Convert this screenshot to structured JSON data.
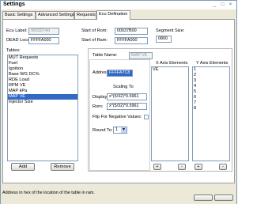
{
  "window": {
    "title": "Settings"
  },
  "tabs": [
    {
      "label": "Basic Settings"
    },
    {
      "label": "Advanced Settings"
    },
    {
      "label": "Requests"
    },
    {
      "label": "Ecu Defination"
    }
  ],
  "ecu_label": {
    "label": "Ecu Label:",
    "value": "9653074d"
  },
  "dead_location": {
    "label": "DEAD Location:",
    "value": "FFFFA000"
  },
  "start_of_rom": {
    "label": "Start of Rom:",
    "value": "00037B00"
  },
  "start_of_ram": {
    "label": "Start of Ram:",
    "value": "FFFFA000"
  },
  "segment_size": {
    "label": "Segment Size:",
    "value": "0800"
  },
  "tables": {
    "label": "Tables:",
    "items": [
      "MUT Requests",
      "Fuel",
      "Ignition",
      "Base WG DC%",
      "RDE Load",
      "RPM VE",
      "MAP kPa",
      "MAP VE",
      "Injector Size"
    ],
    "selected": "MAP VE",
    "add_label": "Add",
    "remove_label": "Remove"
  },
  "table": {
    "name_label": "Table Name:",
    "name_value": "MAP VE",
    "address_label": "Address:",
    "address_value": "FFFFA7C8",
    "scaling_label": "Scaling To",
    "display_label": "Display:",
    "display_value": "x*(5/32)*0.5961",
    "rom_label": "Rom:",
    "rom_value": "x*(5/32)*0.5961",
    "flip_label": "Flip For Negative Values:",
    "round_label": "Round To:",
    "round_value": "1"
  },
  "x_axis": {
    "label": "X Axis Elements",
    "items": [
      "VE"
    ],
    "add": "+",
    "remove": "-"
  },
  "y_axis": {
    "label": "Y Axis Elements",
    "items": [
      "1",
      "2",
      "3",
      "4",
      "5",
      "6",
      "7",
      "8"
    ],
    "add": "+",
    "remove": "-"
  },
  "status": {
    "text": "Address in hex of the location of the table in ram."
  },
  "titlebar_buttons": {
    "minimize": "_",
    "maximize": "□",
    "close": "×"
  }
}
